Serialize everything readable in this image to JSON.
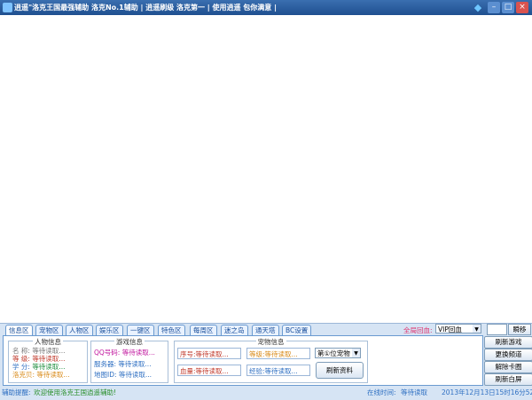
{
  "window": {
    "title": "逍遥\"洛克王国最强辅助 洛克No.1辅助 | 逍遥刷级 洛克第一 | 使用逍遥 包你满意 |"
  },
  "tabs": [
    "信息区",
    "宠物区",
    "人物区",
    "娱乐区",
    "一键区",
    "特色区",
    "每周区",
    "迷之岛",
    "通天塔",
    "BC设置"
  ],
  "quick": {
    "label": "全局回血:",
    "select_value": "VIP回血",
    "button": "瞬移"
  },
  "person_info": {
    "title": "人物信息",
    "rows": [
      {
        "label": "名  称:",
        "value": "等待读取..."
      },
      {
        "label": "等  级:",
        "value": "等待读取..."
      },
      {
        "label": "学  分:",
        "value": "等待读取..."
      },
      {
        "label": "洛克贝:",
        "value": "等待读取..."
      }
    ]
  },
  "game_info": {
    "title": "游戏信息",
    "rows": [
      {
        "label": "QQ号码:",
        "value": "等待读取..."
      },
      {
        "label": "服务器:",
        "value": "等待读取..."
      },
      {
        "label": "地图ID:",
        "value": "等待读取..."
      }
    ]
  },
  "pet_info": {
    "title": "宠物信息",
    "serial": "序号:等待读取...",
    "level": "等级:等待读取...",
    "hp": "血量:等待读取...",
    "exp": "经验:等待读取...",
    "select_value": "第①位宠物",
    "refresh_button": "刷新资料"
  },
  "side_buttons": [
    "刷新游戏",
    "更换频道",
    "解除卡圈",
    "刷新白屏"
  ],
  "status": {
    "label": "辅助提醒:",
    "message": "欢迎使用洛克王国逍遥辅助!",
    "online_label": "在线时间:",
    "online_value": "等待读取",
    "datetime": "2013年12月13日15时16分52秒"
  },
  "colors": {
    "title_bar": "#1f4f8f",
    "accent_red": "#c0392b",
    "accent_pink": "#e0306d"
  }
}
